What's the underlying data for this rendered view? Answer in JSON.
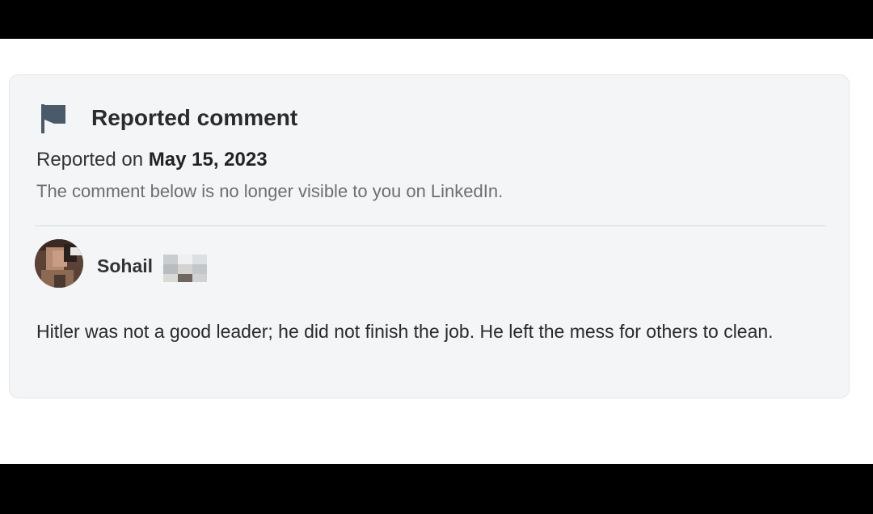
{
  "card": {
    "title": "Reported comment",
    "reported_prefix": "Reported on ",
    "reported_date": "May 15, 2023",
    "visibility_note": "The comment below is no longer visible to you on LinkedIn."
  },
  "comment": {
    "author_name": "Sohail",
    "text": "Hitler was not a good leader; he did not finish the job. He left the mess for others to clean."
  },
  "icons": {
    "flag": "flag-icon"
  },
  "colors": {
    "card_background": "#f3f5f7",
    "flag": "#4a5a6b",
    "muted_text": "#6e6e6e"
  }
}
